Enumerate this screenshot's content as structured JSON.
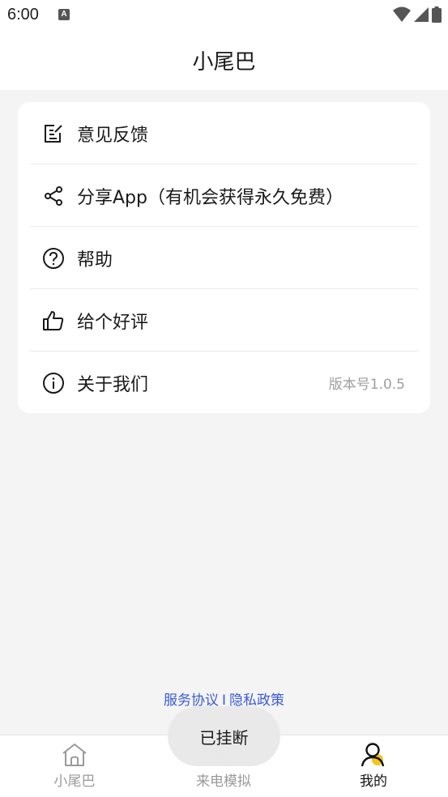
{
  "status_bar": {
    "time": "6:00",
    "notification_icon": "A",
    "icons": [
      "wifi-icon",
      "cell-signal-icon",
      "battery-icon"
    ]
  },
  "header": {
    "title": "小尾巴"
  },
  "menu": {
    "items": [
      {
        "icon": "edit-note-icon",
        "label": "意见反馈"
      },
      {
        "icon": "share-icon",
        "label": "分享App（有机会获得永久免费）"
      },
      {
        "icon": "help-circle-icon",
        "label": "帮助"
      },
      {
        "icon": "thumbs-up-icon",
        "label": "给个好评"
      },
      {
        "icon": "info-circle-icon",
        "label": "关于我们",
        "value": "版本号1.0.5"
      }
    ]
  },
  "footer_links": {
    "terms": "服务协议",
    "separator": "I",
    "privacy": "隐私政策"
  },
  "toast": {
    "message": "已挂断"
  },
  "tabs": [
    {
      "icon": "home-icon",
      "label": "小尾巴",
      "active": false
    },
    {
      "icon": "phone-icon",
      "label": "来电模拟",
      "active": false
    },
    {
      "icon": "profile-icon",
      "label": "我的",
      "active": true
    }
  ],
  "colors": {
    "accent_yellow": "#f5c518",
    "link_blue": "#3b5bd6",
    "background": "#f4f4f4"
  }
}
